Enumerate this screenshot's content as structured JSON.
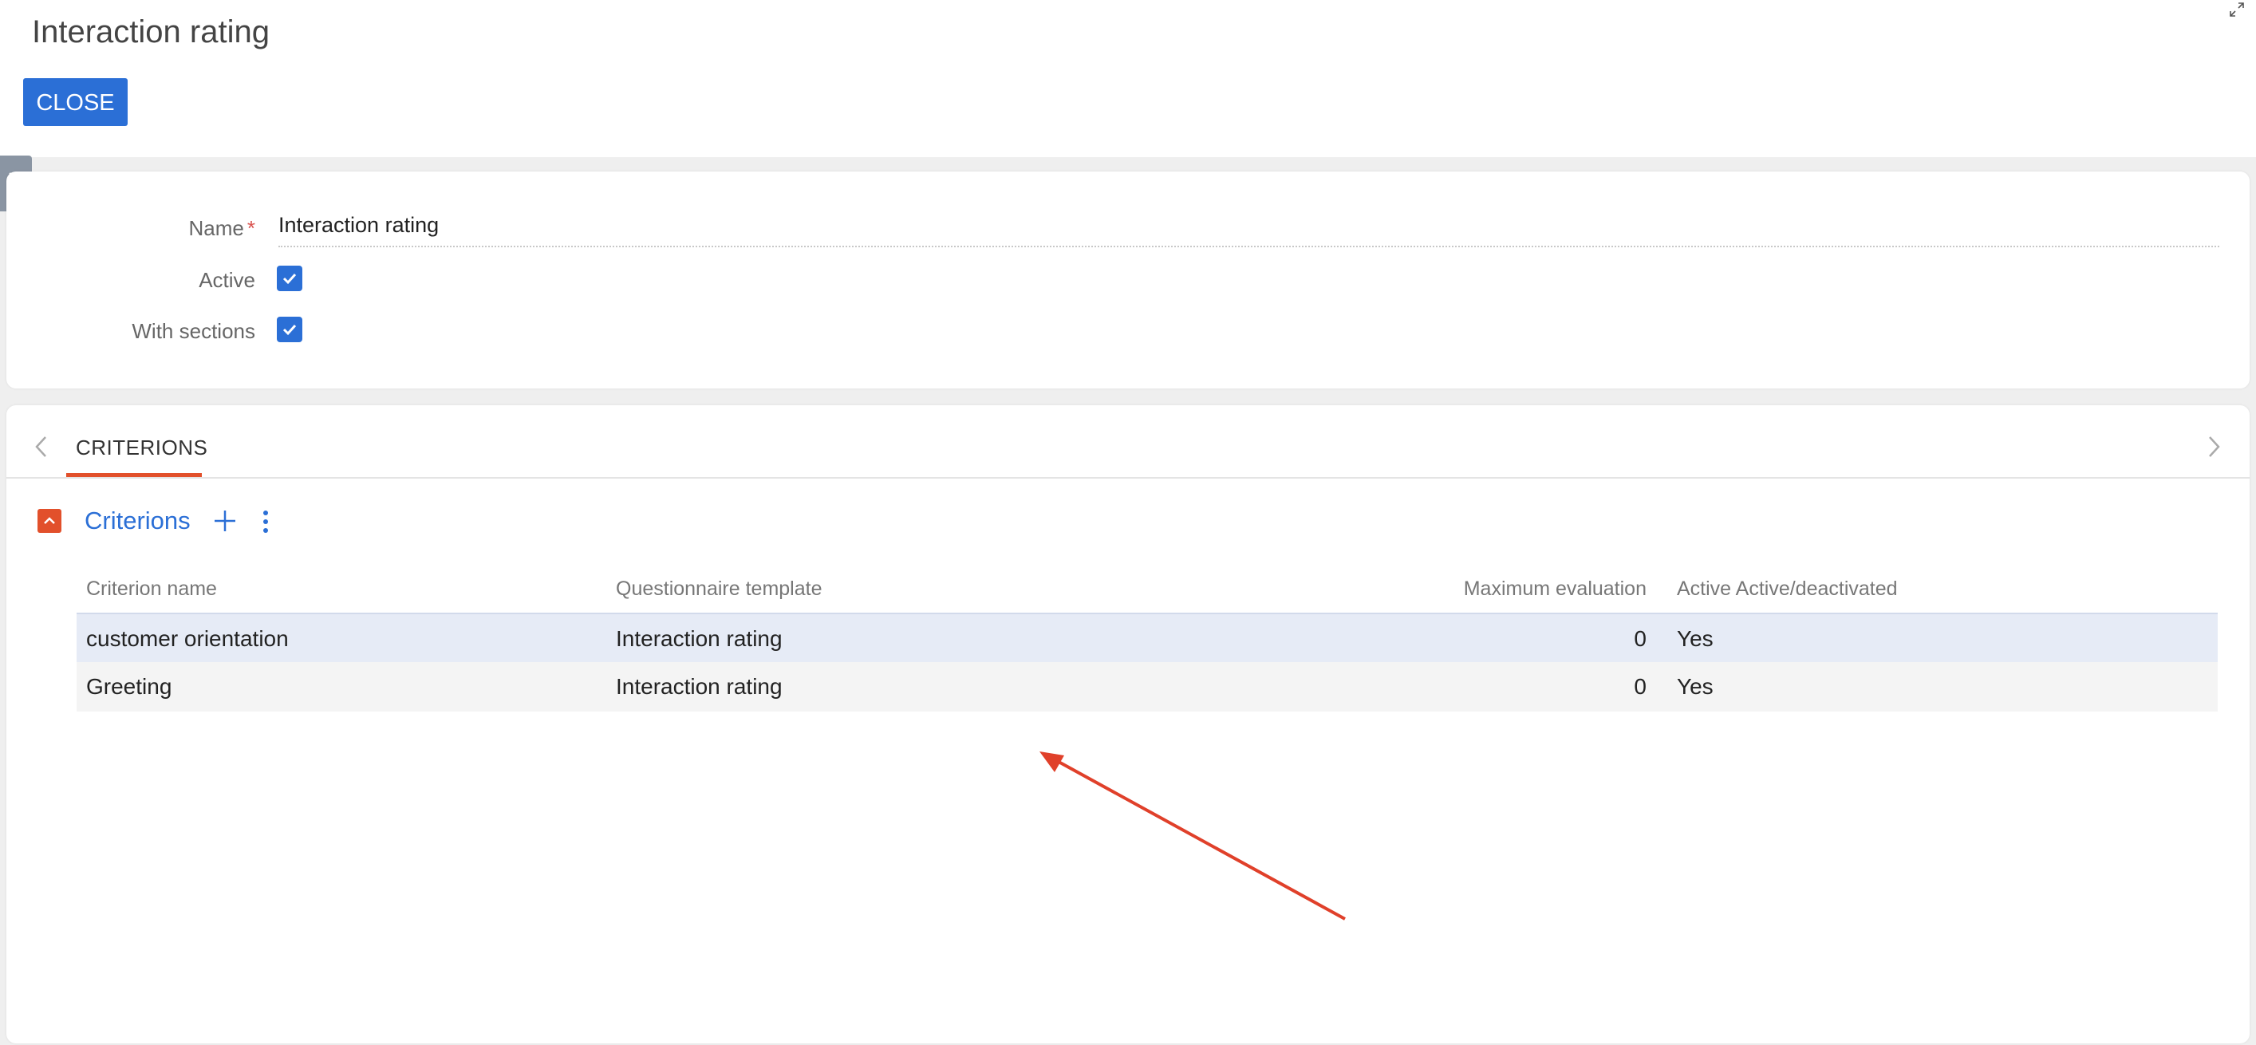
{
  "header": {
    "title": "Interaction rating",
    "close_label": "CLOSE"
  },
  "form": {
    "name_label": "Name",
    "required_mark": "*",
    "name_value": "Interaction rating",
    "active_label": "Active",
    "active_checked": true,
    "with_sections_label": "With sections",
    "with_sections_checked": true
  },
  "tabs": {
    "active_tab": "CRITERIONS"
  },
  "criterions": {
    "section_title": "Criterions",
    "columns": [
      "Criterion name",
      "Questionnaire template",
      "Maximum evaluation",
      "Active Active/deactivated"
    ],
    "rows": [
      {
        "name": "customer orientation",
        "template": "Interaction rating",
        "max": "0",
        "active": "Yes"
      },
      {
        "name": "Greeting",
        "template": "Interaction rating",
        "max": "0",
        "active": "Yes"
      }
    ]
  },
  "colors": {
    "accent_blue": "#2b6fd6",
    "accent_orange": "#e2502b",
    "annotation_red": "#e0402a",
    "selected_row": "#e6ebf6"
  },
  "icons": [
    "expand-icon",
    "sidebar-toggle-chevron-icon",
    "checkmark-icon",
    "chevron-left-icon",
    "chevron-right-icon",
    "collapse-chevron-up-icon",
    "plus-icon",
    "more-vertical-icon",
    "annotation-arrow"
  ]
}
